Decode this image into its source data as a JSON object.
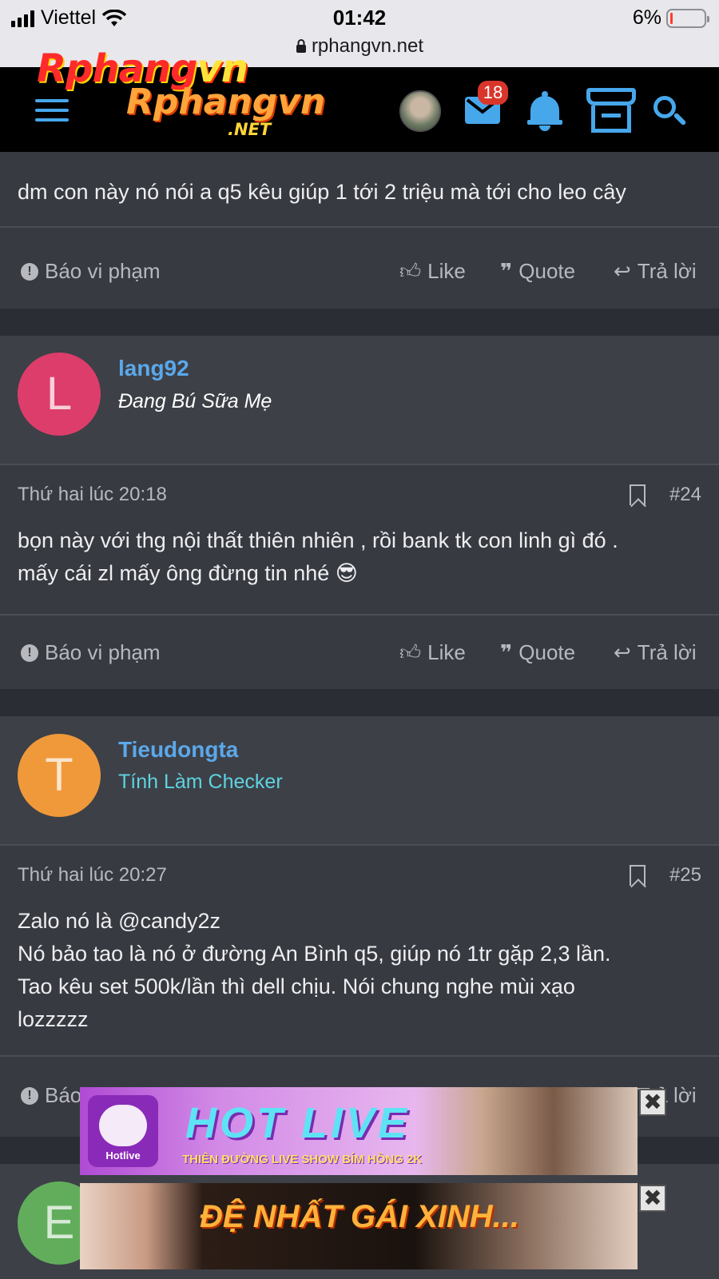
{
  "status_bar": {
    "carrier": "Viettel",
    "time": "01:42",
    "battery": "6%",
    "url": "rphangvn.net"
  },
  "navbar": {
    "logo_line1_a": "Rphang",
    "logo_line1_b": "vn",
    "logo_line2": "Rphangvn",
    "logo_line3": ".NET",
    "mail_badge": "18"
  },
  "posts": [
    {
      "text": "dm con này nó nói a q5 kêu giúp 1 tới 2 triệu mà tới cho leo cây",
      "actions": {
        "report": "Báo vi phạm",
        "like": "Like",
        "quote": "Quote",
        "reply": "Trả lời"
      }
    },
    {
      "user": {
        "initial": "L",
        "name": "lang92",
        "title": "Đang Bú Sữa Mẹ",
        "avatar_color": "#dd3d6a",
        "title_color": "#ffffff"
      },
      "time": "Thứ hai lúc 20:18",
      "number": "#24",
      "text_line1": "bọn này với thg nội thất thiên nhiên , rồi bank tk con linh gì đó .",
      "text_line2": "mấy cái zl mấy ông đừng tin nhé",
      "emoji": "😎",
      "actions": {
        "report": "Báo vi phạm",
        "like": "Like",
        "quote": "Quote",
        "reply": "Trả lời"
      }
    },
    {
      "user": {
        "initial": "T",
        "name": "Tieudongta",
        "title": "Tính Làm Checker",
        "avatar_color": "#f0993a",
        "title_color": "#5fd3e0"
      },
      "time": "Thứ hai lúc 20:27",
      "number": "#25",
      "text_line1": "Zalo nó là @candy2z",
      "text_line2": "Nó bảo tao là nó ở đường An Bình q5, giúp nó 1tr gặp 2,3 lần.",
      "text_line3": "Tao kêu set 500k/lần thì dell chịu. Nói chung nghe mùi xạo",
      "text_line4": "lozzzzz",
      "actions": {
        "report": "Báo",
        "reply": "Trả lời"
      }
    },
    {
      "user": {
        "initial": "E",
        "avatar_color": "#62ad5c"
      }
    }
  ],
  "ads": [
    {
      "title": "HOT LIVE",
      "subtitle": "THIÊN ĐƯỜNG LIVE SHOW BÍM HỒNG 2K",
      "brand": "Hotlive",
      "close": "✖"
    },
    {
      "title": "ĐỆ NHẤT GÁI XINH...",
      "close": "✖"
    }
  ]
}
